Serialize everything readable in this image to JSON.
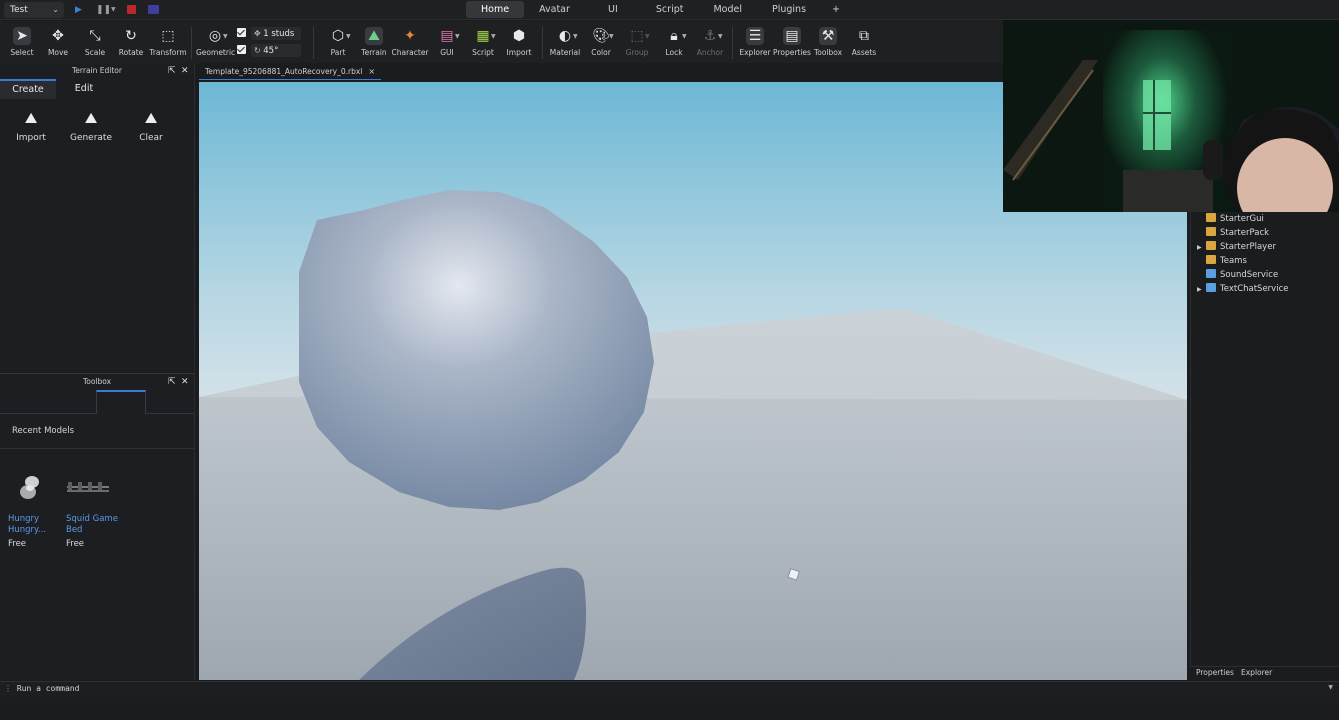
{
  "topbar": {
    "mode": "Test",
    "tabs": [
      {
        "label": "Home",
        "active": true
      },
      {
        "label": "Avatar"
      },
      {
        "label": "UI"
      },
      {
        "label": "Script"
      },
      {
        "label": "Model"
      },
      {
        "label": "Plugins"
      }
    ],
    "add_tab": "+"
  },
  "ribbon": {
    "tools": [
      "Select",
      "Move",
      "Scale",
      "Rotate",
      "Transform",
      "Geometric",
      "Part",
      "Terrain",
      "Character",
      "GUI",
      "Script",
      "Import",
      "Material",
      "Color",
      "Group",
      "Lock",
      "Anchor",
      "Explorer",
      "Properties",
      "Toolbox",
      "Assets"
    ],
    "snap_move": "1 studs",
    "snap_rotate": "45°"
  },
  "terrain_editor": {
    "title": "Terrain Editor",
    "tabs": [
      "Create",
      "Edit"
    ],
    "tools": [
      "Import",
      "Generate",
      "Clear"
    ]
  },
  "toolbox": {
    "title": "Toolbox",
    "section": "Recent Models",
    "models": [
      {
        "name_line1": "Hungry",
        "name_line2": "Hungry...",
        "price": "Free"
      },
      {
        "name_line1": "Squid Game",
        "name_line2": "Bed",
        "price": "Free"
      }
    ]
  },
  "document": {
    "tab_title": "Template_95206881_AutoRecovery_0.rbxl",
    "close": "×"
  },
  "explorer": {
    "items": [
      {
        "label": "StarterGui",
        "expandable": false,
        "color": "#d9a640"
      },
      {
        "label": "StarterPack",
        "expandable": false,
        "color": "#d9a640"
      },
      {
        "label": "StarterPlayer",
        "expandable": true,
        "color": "#d9a640"
      },
      {
        "label": "Teams",
        "expandable": false,
        "color": "#d9a640"
      },
      {
        "label": "SoundService",
        "expandable": false,
        "color": "#5aa0e0"
      },
      {
        "label": "TextChatService",
        "expandable": true,
        "color": "#5aa0e0"
      }
    ],
    "bottom_tabs": [
      "Properties",
      "Explorer"
    ]
  },
  "command_bar": {
    "prompt": "Run a command"
  },
  "colors": {
    "accent": "#3a7bd5",
    "link": "#5a9ae6",
    "background": "#1b1c1e"
  }
}
